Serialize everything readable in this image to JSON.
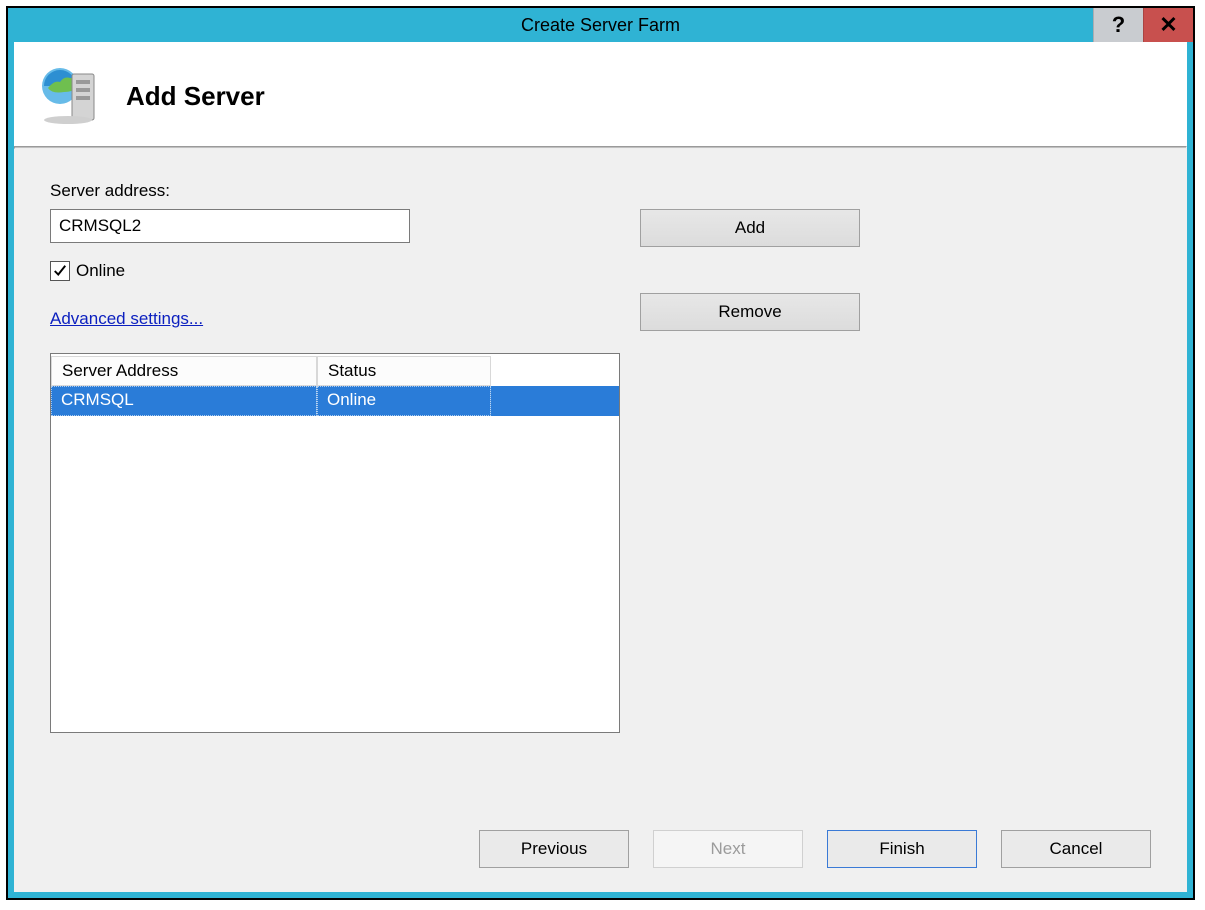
{
  "window": {
    "title": "Create Server Farm"
  },
  "banner": {
    "title": "Add Server"
  },
  "form": {
    "server_address_label": "Server address:",
    "server_address_value": "CRMSQL2",
    "online_label": "Online",
    "online_checked": true,
    "advanced_link": "Advanced settings..."
  },
  "actions": {
    "add": "Add",
    "remove": "Remove"
  },
  "listview": {
    "headers": {
      "c1": "Server Address",
      "c2": "Status"
    },
    "rows": [
      {
        "c1": "CRMSQL",
        "c2": "Online",
        "selected": true
      }
    ]
  },
  "footer": {
    "previous": "Previous",
    "next": "Next",
    "finish": "Finish",
    "cancel": "Cancel"
  }
}
